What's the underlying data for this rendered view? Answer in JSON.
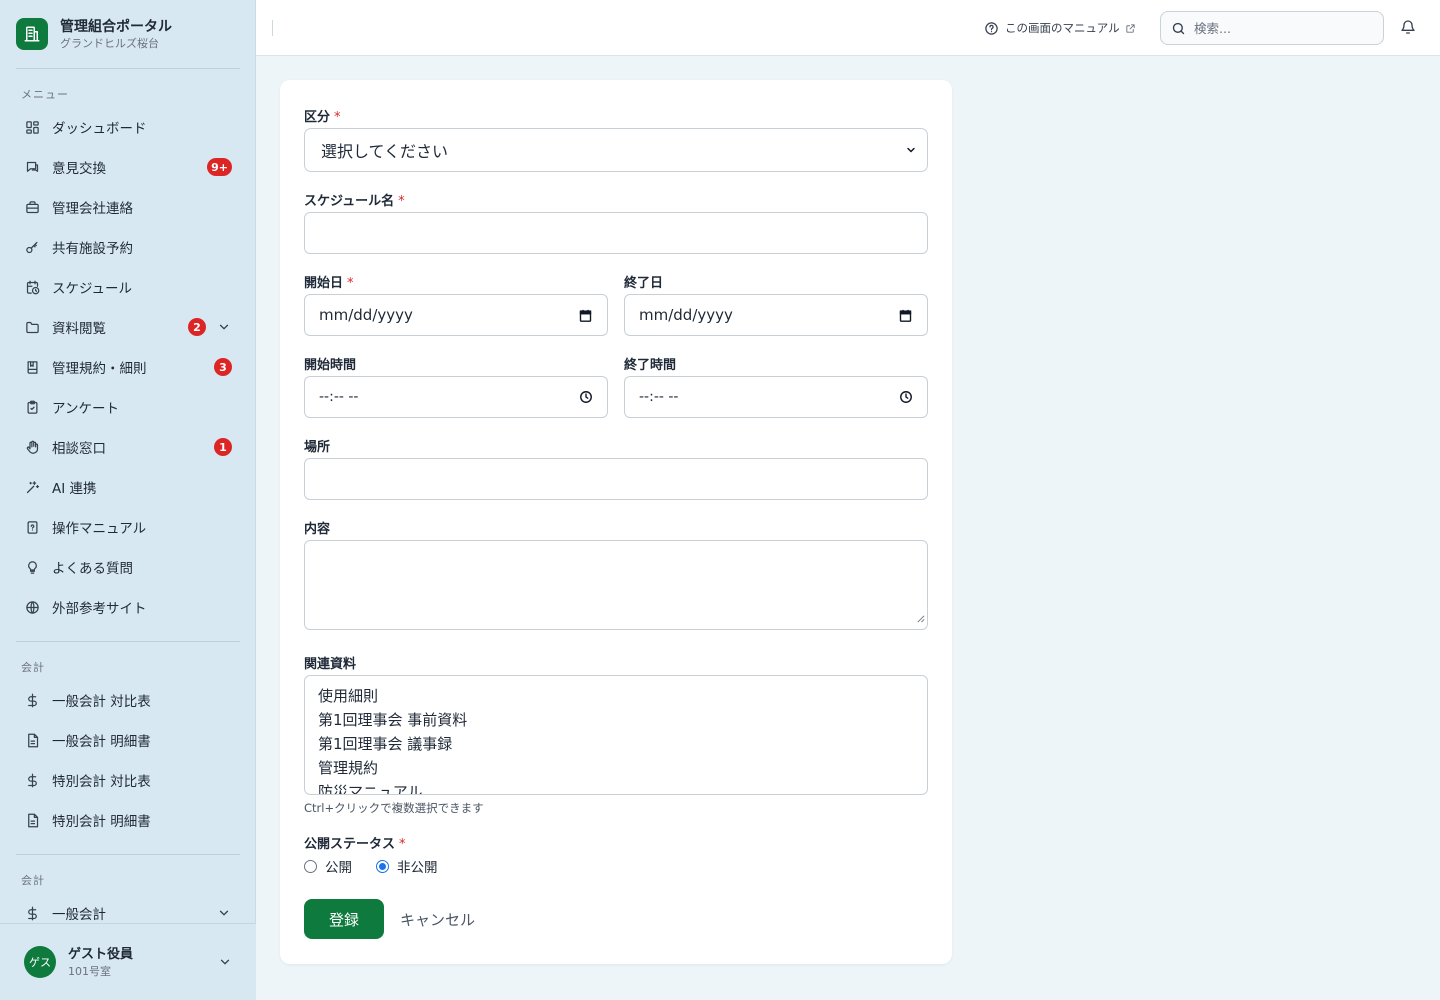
{
  "brand": {
    "title": "管理組合ポータル",
    "subtitle": "グランドヒルズ桜台"
  },
  "sidebar": {
    "menu_label": "メニュー",
    "items": [
      {
        "label": "ダッシュボード",
        "icon": "dashboard-icon"
      },
      {
        "label": "意見交換",
        "icon": "chat-icon",
        "badge": "9+"
      },
      {
        "label": "管理会社連絡",
        "icon": "briefcase-icon"
      },
      {
        "label": "共有施設予約",
        "icon": "key-icon"
      },
      {
        "label": "スケジュール",
        "icon": "calendar-clock-icon"
      },
      {
        "label": "資料閲覧",
        "icon": "folder-icon",
        "badge": "2",
        "expandable": true
      },
      {
        "label": "管理規約・細則",
        "icon": "book-icon",
        "badge": "3"
      },
      {
        "label": "アンケート",
        "icon": "clipboard-icon"
      },
      {
        "label": "相談窓口",
        "icon": "hand-icon",
        "badge": "1"
      },
      {
        "label": "AI 連携",
        "icon": "sparkle-icon"
      },
      {
        "label": "操作マニュアル",
        "icon": "manual-icon"
      },
      {
        "label": "よくある質問",
        "icon": "lightbulb-icon"
      },
      {
        "label": "外部参考サイト",
        "icon": "globe-icon"
      }
    ],
    "accounting_label": "会計",
    "accounting_items": [
      {
        "label": "一般会計 対比表",
        "icon": "dollar-icon"
      },
      {
        "label": "一般会計 明細書",
        "icon": "document-icon"
      },
      {
        "label": "特別会計 対比表",
        "icon": "dollar-icon"
      },
      {
        "label": "特別会計 明細書",
        "icon": "document-icon"
      }
    ],
    "accounting2_label": "会計",
    "accounting2_items": [
      {
        "label": "一般会計",
        "icon": "dollar-icon",
        "expandable": true
      }
    ]
  },
  "user": {
    "avatar": "ゲス",
    "name": "ゲスト役員",
    "room": "101号室"
  },
  "header": {
    "manual_link": "この画面のマニュアル",
    "search_placeholder": "検索..."
  },
  "form": {
    "category": {
      "label": "区分",
      "required": "*",
      "value": "選択してください"
    },
    "name": {
      "label": "スケジュール名",
      "required": "*",
      "value": ""
    },
    "start_date": {
      "label": "開始日",
      "required": "*",
      "value": "mm/dd/yyyy"
    },
    "end_date": {
      "label": "終了日",
      "value": "mm/dd/yyyy"
    },
    "start_time": {
      "label": "開始時間",
      "value": "--:-- --"
    },
    "end_time": {
      "label": "終了時間",
      "value": "--:-- --"
    },
    "location": {
      "label": "場所",
      "value": ""
    },
    "content": {
      "label": "内容",
      "value": ""
    },
    "docs": {
      "label": "関連資料",
      "options": [
        "使用細則",
        "第1回理事会 事前資料",
        "第1回理事会 議事録",
        "管理規約",
        "防災マニュアル"
      ],
      "hint": "Ctrl+クリックで複数選択できます"
    },
    "status": {
      "label": "公開ステータス",
      "required": "*",
      "options": [
        {
          "label": "公開",
          "checked": false
        },
        {
          "label": "非公開",
          "checked": true
        }
      ]
    },
    "submit_label": "登録",
    "cancel_label": "キャンセル"
  }
}
